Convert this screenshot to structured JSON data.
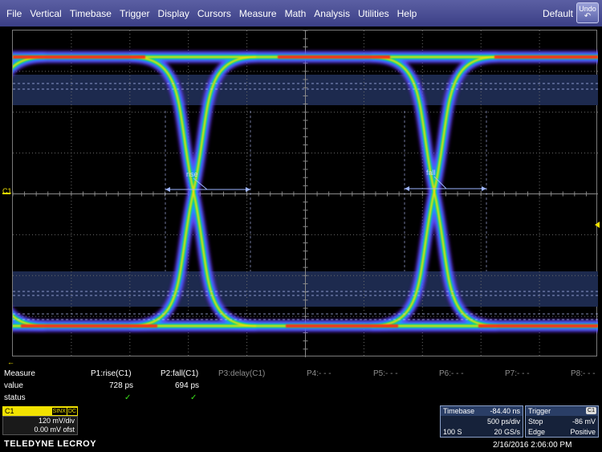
{
  "menubar": {
    "items": [
      "File",
      "Vertical",
      "Timebase",
      "Trigger",
      "Display",
      "Cursors",
      "Measure",
      "Math",
      "Analysis",
      "Utilities",
      "Help"
    ],
    "default_label": "Default",
    "undo_label": "Undo"
  },
  "grid": {
    "channel_marker": "C1",
    "annotations": {
      "rise": "rise",
      "fall": "fall"
    },
    "colors": {
      "hot": "#ff1a1a",
      "warm": "#ffdd00",
      "mid": "#00e070",
      "cool": "#1aa0ff",
      "cold": "#7a2cff",
      "band": "#1d2a4e"
    }
  },
  "measure": {
    "label": "Measure",
    "row_labels": [
      "value",
      "status"
    ],
    "params": [
      {
        "name": "P1:rise(C1)",
        "value": "728 ps",
        "status": "✓",
        "active": true
      },
      {
        "name": "P2:fall(C1)",
        "value": "694 ps",
        "status": "✓",
        "active": true
      },
      {
        "name": "P3:delay(C1)",
        "value": "",
        "status": "",
        "active": false
      },
      {
        "name": "P4:- - -",
        "value": "",
        "status": "",
        "active": false
      },
      {
        "name": "P5:- - -",
        "value": "",
        "status": "",
        "active": false
      },
      {
        "name": "P6:- - -",
        "value": "",
        "status": "",
        "active": false
      },
      {
        "name": "P7:- - -",
        "value": "",
        "status": "",
        "active": false
      },
      {
        "name": "P8:- - -",
        "value": "",
        "status": "",
        "active": false
      }
    ]
  },
  "channel": {
    "name": "C1",
    "tags": [
      "SINX",
      "DC"
    ],
    "vdiv": "120 mV/div",
    "offset": "0.00 mV ofst"
  },
  "timebase": {
    "title": "Timebase",
    "delay": "-84.40 ns",
    "tdiv": "500 ps/div",
    "samples": "100 S",
    "rate": "20 GS/s"
  },
  "trigger": {
    "title": "Trigger",
    "source": "C1",
    "mode": "Stop",
    "level": "-86 mV",
    "type": "Edge",
    "slope": "Positive"
  },
  "footer": {
    "brand": "TELEDYNE LECROY",
    "timestamp": "2/16/2016 2:06:00 PM"
  }
}
